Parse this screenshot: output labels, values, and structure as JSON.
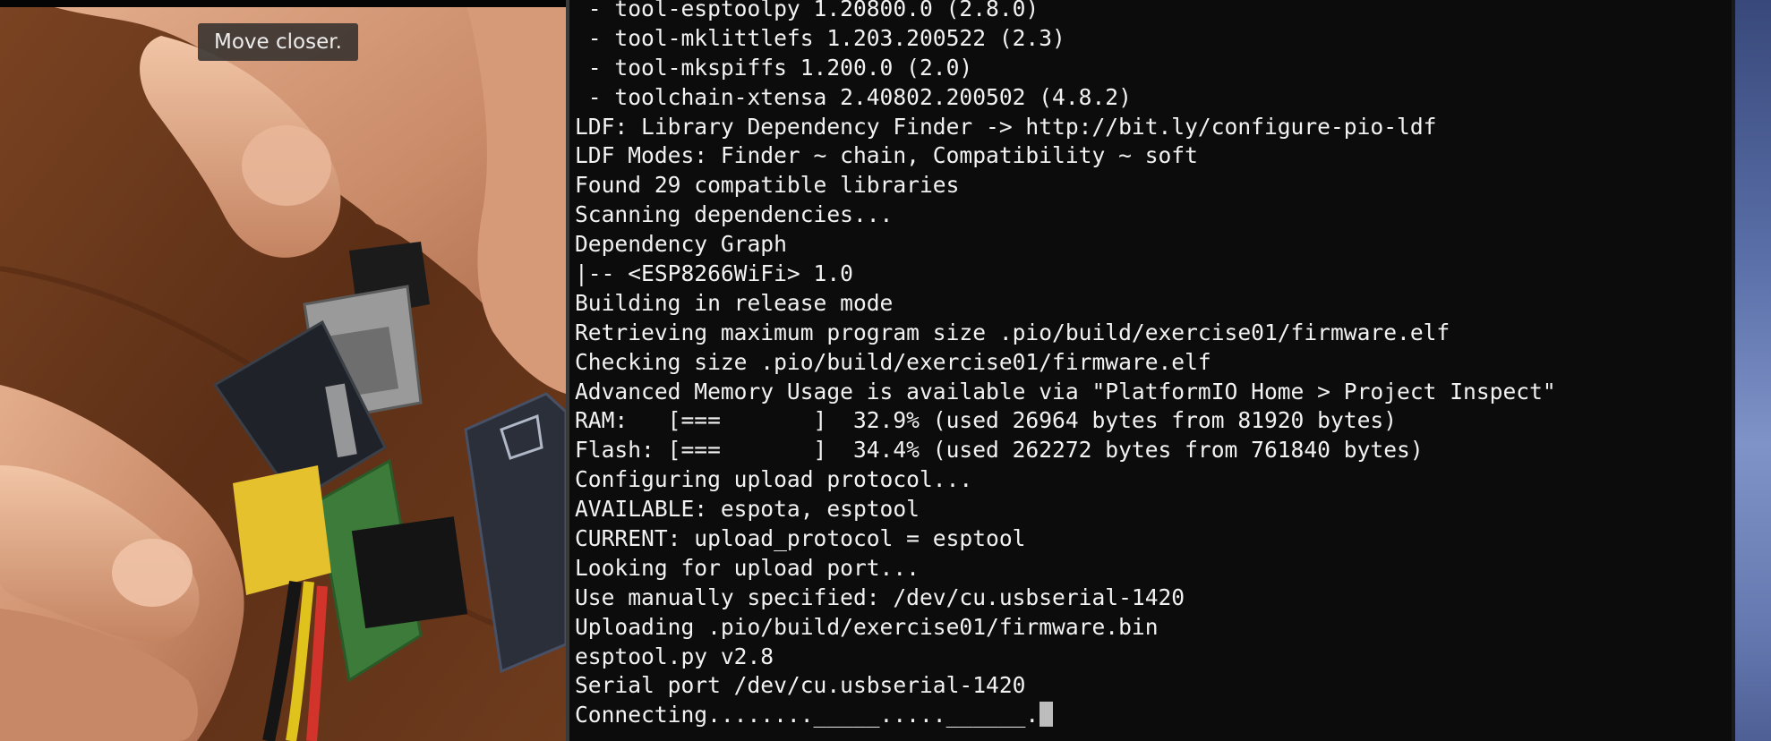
{
  "camera": {
    "hint_text": "Move closer."
  },
  "terminal": {
    "lines": [
      " - tool-esptoolpy 1.20800.0 (2.8.0)",
      " - tool-mklittlefs 1.203.200522 (2.3)",
      " - tool-mkspiffs 1.200.0 (2.0)",
      " - toolchain-xtensa 2.40802.200502 (4.8.2)",
      "LDF: Library Dependency Finder -> http://bit.ly/configure-pio-ldf",
      "LDF Modes: Finder ~ chain, Compatibility ~ soft",
      "Found 29 compatible libraries",
      "Scanning dependencies...",
      "Dependency Graph",
      "|-- <ESP8266WiFi> 1.0",
      "Building in release mode",
      "Retrieving maximum program size .pio/build/exercise01/firmware.elf",
      "Checking size .pio/build/exercise01/firmware.elf",
      "Advanced Memory Usage is available via \"PlatformIO Home > Project Inspect\"",
      "RAM:   [===       ]  32.9% (used 26964 bytes from 81920 bytes)",
      "Flash: [===       ]  34.4% (used 262272 bytes from 761840 bytes)",
      "Configuring upload protocol...",
      "AVAILABLE: espota, esptool",
      "CURRENT: upload_protocol = esptool",
      "Looking for upload port...",
      "Use manually specified: /dev/cu.usbserial-1420",
      "Uploading .pio/build/exercise01/firmware.bin",
      "esptool.py v2.8",
      "Serial port /dev/cu.usbserial-1420",
      "Connecting........_____.....______."
    ]
  },
  "colors": {
    "terminal_bg": "#0c0c0c",
    "terminal_fg": "#f2f2f2",
    "cursor": "#bdbdbd",
    "desktop_edge": "#6579b0"
  }
}
